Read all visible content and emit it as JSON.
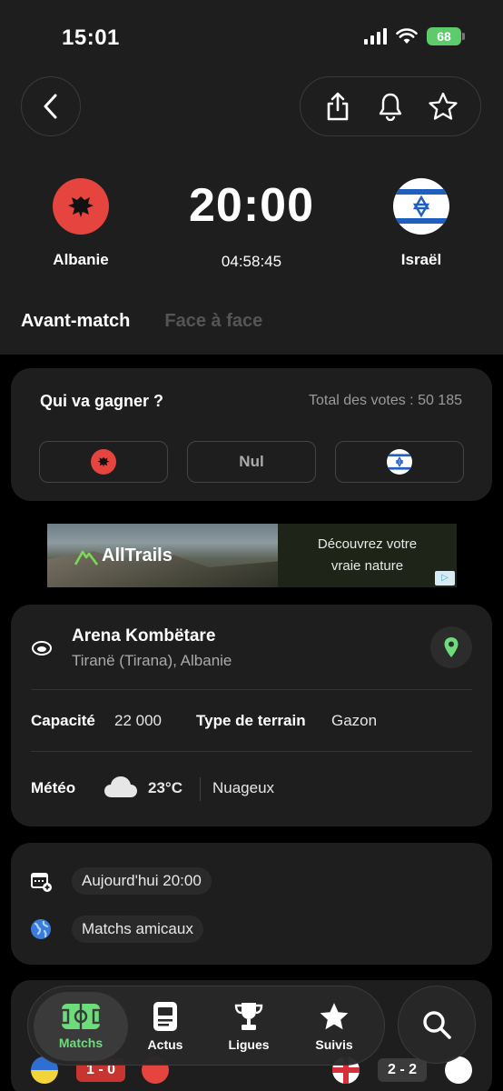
{
  "status_bar": {
    "time": "15:01",
    "battery": "68"
  },
  "header": {
    "back_icon": "chevron-left-icon",
    "actions": [
      "share-icon",
      "bell-icon",
      "star-icon"
    ]
  },
  "match": {
    "home": {
      "name": "Albanie",
      "flag": "albania-flag-icon",
      "color": "#e5443f"
    },
    "away": {
      "name": "Israël",
      "flag": "israel-flag-icon",
      "color": "#1f5fbf"
    },
    "kickoff": "20:00",
    "countdown": "04:58:45"
  },
  "tabs": {
    "active": "Avant-match",
    "inactive": "Face à face"
  },
  "vote": {
    "title": "Qui va gagner ?",
    "total": "Total des votes : 50 185",
    "draw_label": "Nul"
  },
  "ad": {
    "brand": "AllTrails",
    "line1": "Découvrez votre",
    "line2": "vraie nature"
  },
  "venue": {
    "name": "Arena Kombëtare",
    "city": "Tiranë (Tirana), Albanie",
    "capacity_label": "Capacité",
    "capacity_value": "22 000",
    "surface_label": "Type de terrain",
    "surface_value": "Gazon",
    "weather_label": "Météo",
    "temperature": "23°C",
    "weather_desc": "Nuageux"
  },
  "info": {
    "date": "Aujourd'hui 20:00",
    "competition": "Matchs amicaux"
  },
  "peek": {
    "score1": "1 - 0",
    "score2": "2 - 2"
  },
  "nav": {
    "items": [
      "Matchs",
      "Actus",
      "Ligues",
      "Suivis"
    ],
    "active": "Matchs",
    "accent": "#6ddc7a"
  }
}
